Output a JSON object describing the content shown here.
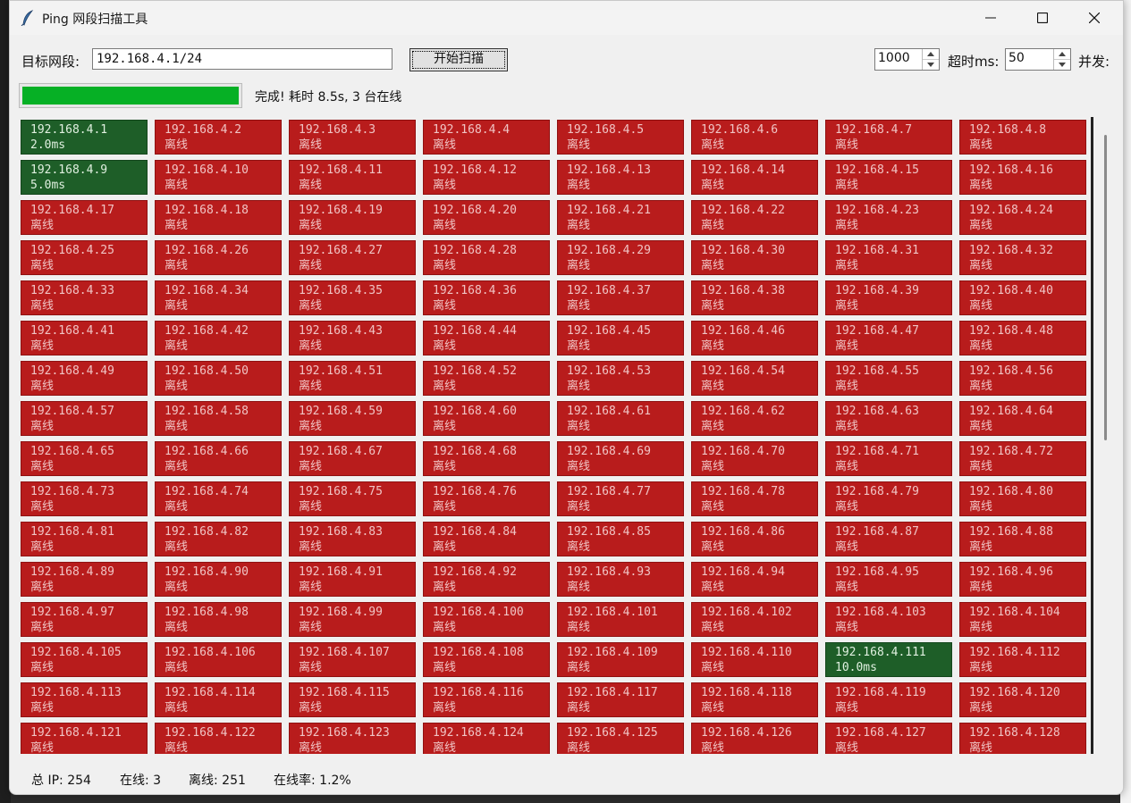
{
  "window": {
    "title": "Ping 网段扫描工具"
  },
  "controls": {
    "target_label": "目标网段:",
    "target_value": "192.168.4.1/24",
    "scan_button": "开始扫描",
    "spin_a_value": "1000",
    "timeout_label": "超时ms:",
    "spin_b_value": "50",
    "concurrency_label": "并发:"
  },
  "progress": {
    "value_percent": 100,
    "status_text": "完成! 耗时 8.5s, 3 台在线",
    "fill_color": "#06b025"
  },
  "colors": {
    "online_bg": "#1e5e28",
    "offline_bg": "#b81c1c"
  },
  "grid": {
    "columns": 8,
    "offline_text": "离线",
    "cells": [
      {
        "ip": "192.168.4.1",
        "status": "2.0ms",
        "online": true
      },
      {
        "ip": "192.168.4.2",
        "status": "离线",
        "online": false
      },
      {
        "ip": "192.168.4.3",
        "status": "离线",
        "online": false
      },
      {
        "ip": "192.168.4.4",
        "status": "离线",
        "online": false
      },
      {
        "ip": "192.168.4.5",
        "status": "离线",
        "online": false
      },
      {
        "ip": "192.168.4.6",
        "status": "离线",
        "online": false
      },
      {
        "ip": "192.168.4.7",
        "status": "离线",
        "online": false
      },
      {
        "ip": "192.168.4.8",
        "status": "离线",
        "online": false
      },
      {
        "ip": "192.168.4.9",
        "status": "5.0ms",
        "online": true
      },
      {
        "ip": "192.168.4.10",
        "status": "离线",
        "online": false
      },
      {
        "ip": "192.168.4.11",
        "status": "离线",
        "online": false
      },
      {
        "ip": "192.168.4.12",
        "status": "离线",
        "online": false
      },
      {
        "ip": "192.168.4.13",
        "status": "离线",
        "online": false
      },
      {
        "ip": "192.168.4.14",
        "status": "离线",
        "online": false
      },
      {
        "ip": "192.168.4.15",
        "status": "离线",
        "online": false
      },
      {
        "ip": "192.168.4.16",
        "status": "离线",
        "online": false
      },
      {
        "ip": "192.168.4.17",
        "status": "离线",
        "online": false
      },
      {
        "ip": "192.168.4.18",
        "status": "离线",
        "online": false
      },
      {
        "ip": "192.168.4.19",
        "status": "离线",
        "online": false
      },
      {
        "ip": "192.168.4.20",
        "status": "离线",
        "online": false
      },
      {
        "ip": "192.168.4.21",
        "status": "离线",
        "online": false
      },
      {
        "ip": "192.168.4.22",
        "status": "离线",
        "online": false
      },
      {
        "ip": "192.168.4.23",
        "status": "离线",
        "online": false
      },
      {
        "ip": "192.168.4.24",
        "status": "离线",
        "online": false
      },
      {
        "ip": "192.168.4.25",
        "status": "离线",
        "online": false
      },
      {
        "ip": "192.168.4.26",
        "status": "离线",
        "online": false
      },
      {
        "ip": "192.168.4.27",
        "status": "离线",
        "online": false
      },
      {
        "ip": "192.168.4.28",
        "status": "离线",
        "online": false
      },
      {
        "ip": "192.168.4.29",
        "status": "离线",
        "online": false
      },
      {
        "ip": "192.168.4.30",
        "status": "离线",
        "online": false
      },
      {
        "ip": "192.168.4.31",
        "status": "离线",
        "online": false
      },
      {
        "ip": "192.168.4.32",
        "status": "离线",
        "online": false
      },
      {
        "ip": "192.168.4.33",
        "status": "离线",
        "online": false
      },
      {
        "ip": "192.168.4.34",
        "status": "离线",
        "online": false
      },
      {
        "ip": "192.168.4.35",
        "status": "离线",
        "online": false
      },
      {
        "ip": "192.168.4.36",
        "status": "离线",
        "online": false
      },
      {
        "ip": "192.168.4.37",
        "status": "离线",
        "online": false
      },
      {
        "ip": "192.168.4.38",
        "status": "离线",
        "online": false
      },
      {
        "ip": "192.168.4.39",
        "status": "离线",
        "online": false
      },
      {
        "ip": "192.168.4.40",
        "status": "离线",
        "online": false
      },
      {
        "ip": "192.168.4.41",
        "status": "离线",
        "online": false
      },
      {
        "ip": "192.168.4.42",
        "status": "离线",
        "online": false
      },
      {
        "ip": "192.168.4.43",
        "status": "离线",
        "online": false
      },
      {
        "ip": "192.168.4.44",
        "status": "离线",
        "online": false
      },
      {
        "ip": "192.168.4.45",
        "status": "离线",
        "online": false
      },
      {
        "ip": "192.168.4.46",
        "status": "离线",
        "online": false
      },
      {
        "ip": "192.168.4.47",
        "status": "离线",
        "online": false
      },
      {
        "ip": "192.168.4.48",
        "status": "离线",
        "online": false
      },
      {
        "ip": "192.168.4.49",
        "status": "离线",
        "online": false
      },
      {
        "ip": "192.168.4.50",
        "status": "离线",
        "online": false
      },
      {
        "ip": "192.168.4.51",
        "status": "离线",
        "online": false
      },
      {
        "ip": "192.168.4.52",
        "status": "离线",
        "online": false
      },
      {
        "ip": "192.168.4.53",
        "status": "离线",
        "online": false
      },
      {
        "ip": "192.168.4.54",
        "status": "离线",
        "online": false
      },
      {
        "ip": "192.168.4.55",
        "status": "离线",
        "online": false
      },
      {
        "ip": "192.168.4.56",
        "status": "离线",
        "online": false
      },
      {
        "ip": "192.168.4.57",
        "status": "离线",
        "online": false
      },
      {
        "ip": "192.168.4.58",
        "status": "离线",
        "online": false
      },
      {
        "ip": "192.168.4.59",
        "status": "离线",
        "online": false
      },
      {
        "ip": "192.168.4.60",
        "status": "离线",
        "online": false
      },
      {
        "ip": "192.168.4.61",
        "status": "离线",
        "online": false
      },
      {
        "ip": "192.168.4.62",
        "status": "离线",
        "online": false
      },
      {
        "ip": "192.168.4.63",
        "status": "离线",
        "online": false
      },
      {
        "ip": "192.168.4.64",
        "status": "离线",
        "online": false
      },
      {
        "ip": "192.168.4.65",
        "status": "离线",
        "online": false
      },
      {
        "ip": "192.168.4.66",
        "status": "离线",
        "online": false
      },
      {
        "ip": "192.168.4.67",
        "status": "离线",
        "online": false
      },
      {
        "ip": "192.168.4.68",
        "status": "离线",
        "online": false
      },
      {
        "ip": "192.168.4.69",
        "status": "离线",
        "online": false
      },
      {
        "ip": "192.168.4.70",
        "status": "离线",
        "online": false
      },
      {
        "ip": "192.168.4.71",
        "status": "离线",
        "online": false
      },
      {
        "ip": "192.168.4.72",
        "status": "离线",
        "online": false
      },
      {
        "ip": "192.168.4.73",
        "status": "离线",
        "online": false
      },
      {
        "ip": "192.168.4.74",
        "status": "离线",
        "online": false
      },
      {
        "ip": "192.168.4.75",
        "status": "离线",
        "online": false
      },
      {
        "ip": "192.168.4.76",
        "status": "离线",
        "online": false
      },
      {
        "ip": "192.168.4.77",
        "status": "离线",
        "online": false
      },
      {
        "ip": "192.168.4.78",
        "status": "离线",
        "online": false
      },
      {
        "ip": "192.168.4.79",
        "status": "离线",
        "online": false
      },
      {
        "ip": "192.168.4.80",
        "status": "离线",
        "online": false
      },
      {
        "ip": "192.168.4.81",
        "status": "离线",
        "online": false
      },
      {
        "ip": "192.168.4.82",
        "status": "离线",
        "online": false
      },
      {
        "ip": "192.168.4.83",
        "status": "离线",
        "online": false
      },
      {
        "ip": "192.168.4.84",
        "status": "离线",
        "online": false
      },
      {
        "ip": "192.168.4.85",
        "status": "离线",
        "online": false
      },
      {
        "ip": "192.168.4.86",
        "status": "离线",
        "online": false
      },
      {
        "ip": "192.168.4.87",
        "status": "离线",
        "online": false
      },
      {
        "ip": "192.168.4.88",
        "status": "离线",
        "online": false
      },
      {
        "ip": "192.168.4.89",
        "status": "离线",
        "online": false
      },
      {
        "ip": "192.168.4.90",
        "status": "离线",
        "online": false
      },
      {
        "ip": "192.168.4.91",
        "status": "离线",
        "online": false
      },
      {
        "ip": "192.168.4.92",
        "status": "离线",
        "online": false
      },
      {
        "ip": "192.168.4.93",
        "status": "离线",
        "online": false
      },
      {
        "ip": "192.168.4.94",
        "status": "离线",
        "online": false
      },
      {
        "ip": "192.168.4.95",
        "status": "离线",
        "online": false
      },
      {
        "ip": "192.168.4.96",
        "status": "离线",
        "online": false
      },
      {
        "ip": "192.168.4.97",
        "status": "离线",
        "online": false
      },
      {
        "ip": "192.168.4.98",
        "status": "离线",
        "online": false
      },
      {
        "ip": "192.168.4.99",
        "status": "离线",
        "online": false
      },
      {
        "ip": "192.168.4.100",
        "status": "离线",
        "online": false
      },
      {
        "ip": "192.168.4.101",
        "status": "离线",
        "online": false
      },
      {
        "ip": "192.168.4.102",
        "status": "离线",
        "online": false
      },
      {
        "ip": "192.168.4.103",
        "status": "离线",
        "online": false
      },
      {
        "ip": "192.168.4.104",
        "status": "离线",
        "online": false
      },
      {
        "ip": "192.168.4.105",
        "status": "离线",
        "online": false
      },
      {
        "ip": "192.168.4.106",
        "status": "离线",
        "online": false
      },
      {
        "ip": "192.168.4.107",
        "status": "离线",
        "online": false
      },
      {
        "ip": "192.168.4.108",
        "status": "离线",
        "online": false
      },
      {
        "ip": "192.168.4.109",
        "status": "离线",
        "online": false
      },
      {
        "ip": "192.168.4.110",
        "status": "离线",
        "online": false
      },
      {
        "ip": "192.168.4.111",
        "status": "10.0ms",
        "online": true
      },
      {
        "ip": "192.168.4.112",
        "status": "离线",
        "online": false
      },
      {
        "ip": "192.168.4.113",
        "status": "离线",
        "online": false
      },
      {
        "ip": "192.168.4.114",
        "status": "离线",
        "online": false
      },
      {
        "ip": "192.168.4.115",
        "status": "离线",
        "online": false
      },
      {
        "ip": "192.168.4.116",
        "status": "离线",
        "online": false
      },
      {
        "ip": "192.168.4.117",
        "status": "离线",
        "online": false
      },
      {
        "ip": "192.168.4.118",
        "status": "离线",
        "online": false
      },
      {
        "ip": "192.168.4.119",
        "status": "离线",
        "online": false
      },
      {
        "ip": "192.168.4.120",
        "status": "离线",
        "online": false
      },
      {
        "ip": "192.168.4.121",
        "status": "离线",
        "online": false
      },
      {
        "ip": "192.168.4.122",
        "status": "离线",
        "online": false
      },
      {
        "ip": "192.168.4.123",
        "status": "离线",
        "online": false
      },
      {
        "ip": "192.168.4.124",
        "status": "离线",
        "online": false
      },
      {
        "ip": "192.168.4.125",
        "status": "离线",
        "online": false
      },
      {
        "ip": "192.168.4.126",
        "status": "离线",
        "online": false
      },
      {
        "ip": "192.168.4.127",
        "status": "离线",
        "online": false
      },
      {
        "ip": "192.168.4.128",
        "status": "离线",
        "online": false
      }
    ]
  },
  "footer": {
    "total": "总 IP: 254",
    "online": "在线: 3",
    "offline": "离线: 251",
    "rate": "在线率: 1.2%"
  }
}
